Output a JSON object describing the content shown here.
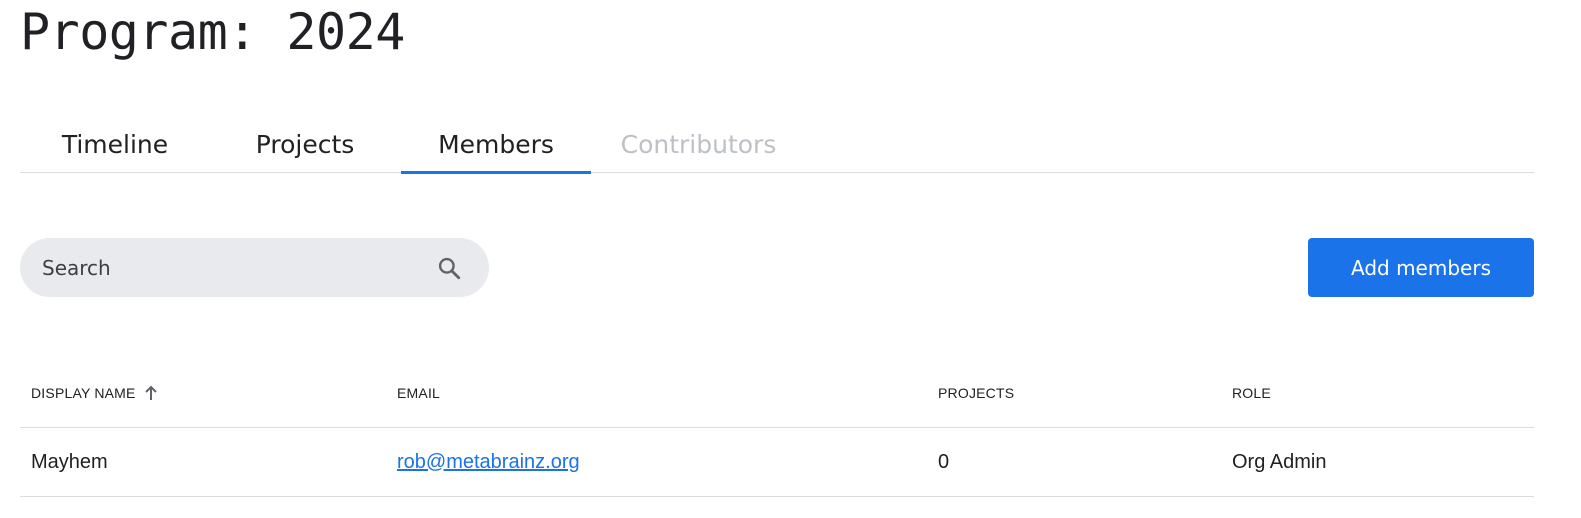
{
  "page": {
    "title": "Program: 2024"
  },
  "tabs": [
    {
      "label": "Timeline",
      "active": false,
      "disabled": false
    },
    {
      "label": "Projects",
      "active": false,
      "disabled": false
    },
    {
      "label": "Members",
      "active": true,
      "disabled": false
    },
    {
      "label": "Contributors",
      "active": false,
      "disabled": true
    }
  ],
  "search": {
    "placeholder": "Search",
    "value": "",
    "icon": "search-icon"
  },
  "actions": {
    "add_members_label": "Add members"
  },
  "table": {
    "columns": [
      "DISPLAY NAME",
      "EMAIL",
      "PROJECTS",
      "ROLE"
    ],
    "sort": {
      "column": "DISPLAY NAME",
      "direction": "ascending",
      "icon": "arrow-up-icon"
    },
    "rows": [
      {
        "display_name": "Mayhem",
        "email": "rob@metabrainz.org",
        "projects": "0",
        "role": "Org Admin"
      }
    ]
  },
  "colors": {
    "accent": "#1a73e8",
    "disabled_tab": "#bdc1c6",
    "search_bg": "#e8eaed",
    "divider": "#dadce0"
  }
}
